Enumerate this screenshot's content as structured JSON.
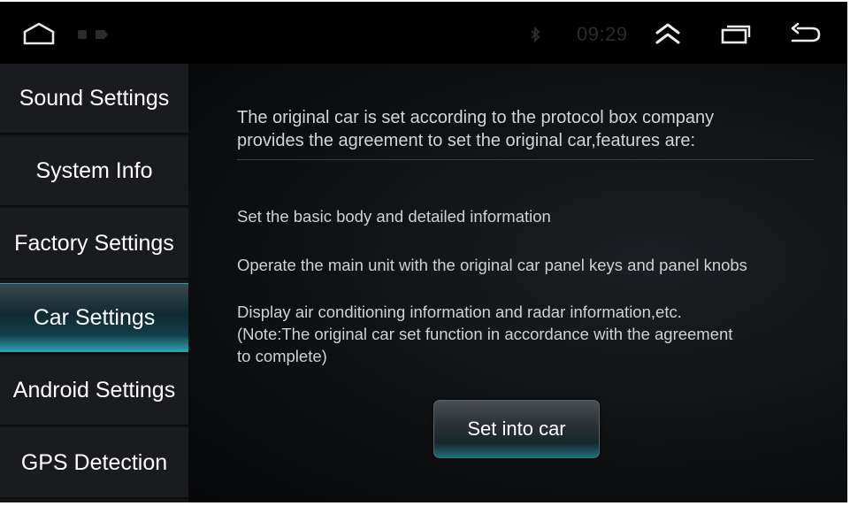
{
  "status_bar": {
    "time": "09:29",
    "icons": [
      "home-icon",
      "notification-icons",
      "bluetooth-icon",
      "expand-up-icon",
      "recents-icon",
      "back-icon"
    ]
  },
  "sidebar": {
    "items": [
      {
        "label": "Sound Settings",
        "active": false
      },
      {
        "label": "System Info",
        "active": false
      },
      {
        "label": "Factory Settings",
        "active": false
      },
      {
        "label": "Car Settings",
        "active": true
      },
      {
        "label": "Android Settings",
        "active": false
      },
      {
        "label": "GPS Detection",
        "active": false
      }
    ]
  },
  "main": {
    "intro_line1": "The original car is set according to the protocol box company",
    "intro_line2": "provides the agreement to set the original car,features are:",
    "feature1": "Set the basic body and detailed information",
    "feature2": "Operate the main unit with the original car panel keys and panel knobs",
    "feature3_line1": "Display air conditioning information and radar information,etc.",
    "feature3_line2": "(Note:The original car set function in accordance with the agreement",
    "feature3_line3": "to complete)",
    "button_label": "Set into car"
  },
  "colors": {
    "accent": "#2aa7b3",
    "background": "#050608",
    "text": "#d2d4d6"
  }
}
